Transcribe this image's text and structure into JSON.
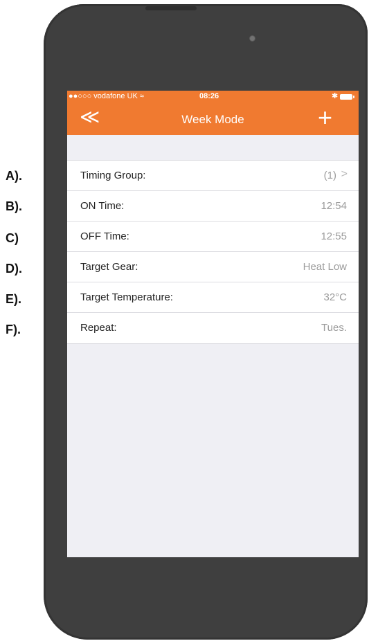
{
  "status_bar": {
    "carrier": "●●○○○ vodafone UK ≈",
    "time": "08:26",
    "bluetooth": "✱"
  },
  "nav": {
    "back_glyph": "≪",
    "title": "Week Mode",
    "add_glyph": "+"
  },
  "rows": [
    {
      "label": "Timing Group:",
      "value": "(1)",
      "chevron": ">"
    },
    {
      "label": "ON Time:",
      "value": "12:54"
    },
    {
      "label": "OFF Time:",
      "value": "12:55"
    },
    {
      "label": "Target Gear:",
      "value": "Heat Low"
    },
    {
      "label": "Target Temperature:",
      "value": "32°C"
    },
    {
      "label": "Repeat:",
      "value": "Tues."
    }
  ],
  "annotations": [
    "A).",
    "B).",
    "C)",
    "D).",
    "E).",
    "F)."
  ],
  "colors": {
    "accent": "#f07a30",
    "background": "#efeff4",
    "phone_body": "#3f3f3f"
  }
}
